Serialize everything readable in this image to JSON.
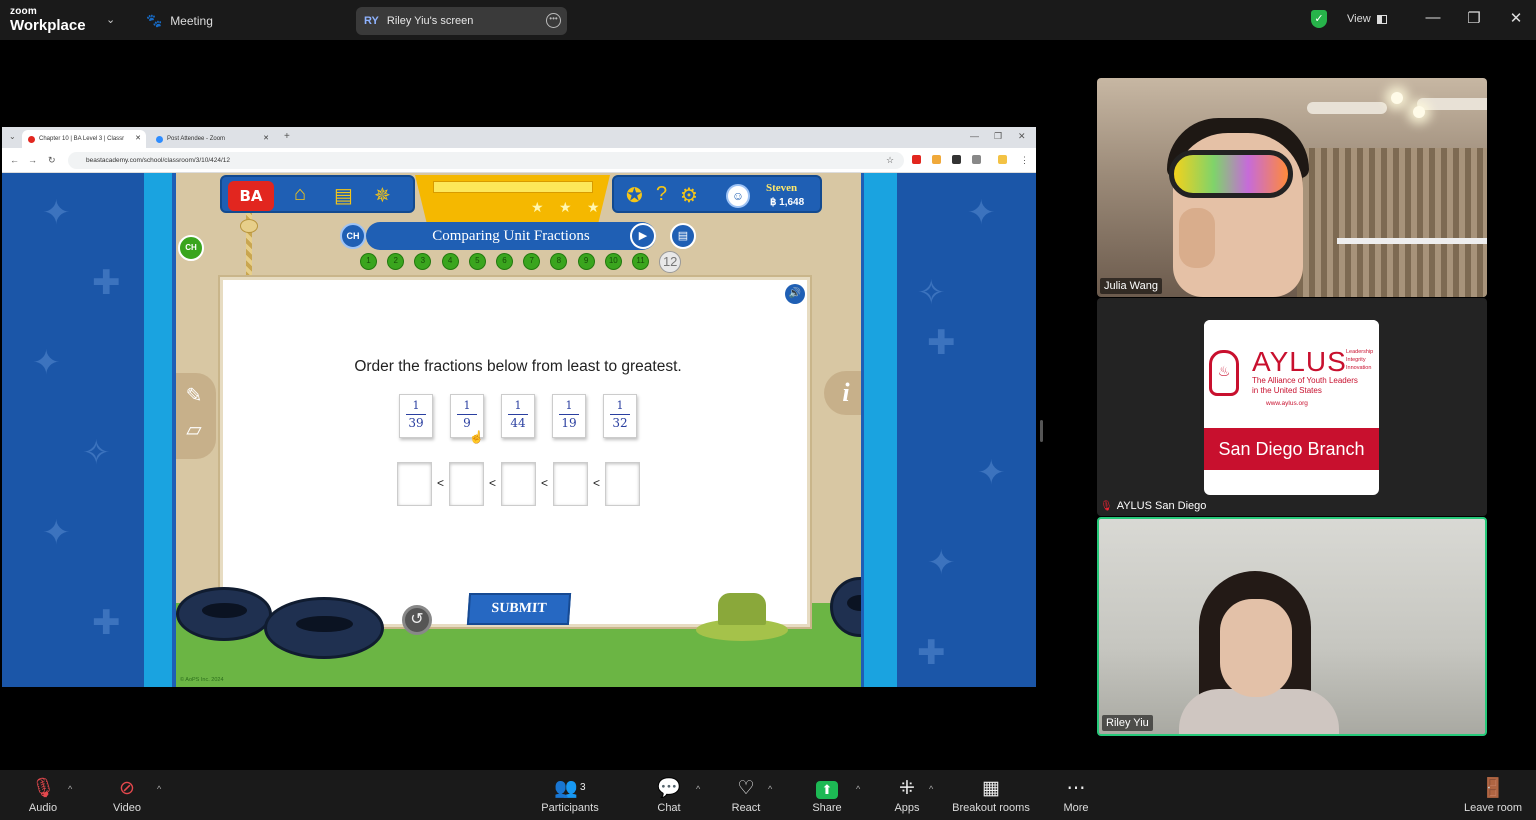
{
  "topbar": {
    "brand_small": "zoom",
    "brand_large": "Workplace",
    "meeting_label": "Meeting",
    "share_initials": "RY",
    "share_title": "Riley Yiu's screen",
    "view_label": "View"
  },
  "browser": {
    "tabs": [
      {
        "label": "Chapter 10 | BA Level 3 | Classr"
      },
      {
        "label": "Post Attendee - Zoom"
      }
    ],
    "new_tab": "+",
    "url": "beastacademy.com/school/classroom/3/10/424/12"
  },
  "game": {
    "logo": "BA",
    "user_name": "Steven",
    "coins": "฿ 1,648",
    "chapter_badge": "CH",
    "lesson_title": "Comparing Unit Fractions",
    "progress": [
      "1",
      "2",
      "3",
      "4",
      "5",
      "6",
      "7",
      "8",
      "9",
      "10",
      "11",
      "12"
    ],
    "current_step": "12",
    "question": "Order the fractions below from least to greatest.",
    "fractions": [
      {
        "num": "1",
        "den": "39"
      },
      {
        "num": "1",
        "den": "9"
      },
      {
        "num": "1",
        "den": "44"
      },
      {
        "num": "1",
        "den": "19"
      },
      {
        "num": "1",
        "den": "32"
      }
    ],
    "comparator": "<",
    "submit_label": "SUBMIT",
    "info_label": "i",
    "copyright": "© AoPS Inc. 2024"
  },
  "participants": [
    {
      "name": "Julia Wang"
    },
    {
      "name": "AYLUS San Diego",
      "muted": true
    },
    {
      "name": "Riley Yiu",
      "active_speaker": true
    }
  ],
  "aylus_card": {
    "name": "AYLUS",
    "motto": [
      "Leadership",
      "Integrity",
      "Innovation"
    ],
    "tagline": [
      "The Alliance of Youth Leaders",
      "in the United States"
    ],
    "website": "www.aylus.org",
    "branch": "San Diego Branch"
  },
  "toolbar": {
    "audio": "Audio",
    "video": "Video",
    "participants": "Participants",
    "participants_count": "3",
    "chat": "Chat",
    "react": "React",
    "share": "Share",
    "apps": "Apps",
    "breakout": "Breakout rooms",
    "more": "More",
    "leave": "Leave room"
  },
  "colors": {
    "share_green": "#1db954",
    "active_speaker_border": "#26c97a",
    "game_blue": "#1f5fb4",
    "aylus_red": "#c8102e"
  }
}
